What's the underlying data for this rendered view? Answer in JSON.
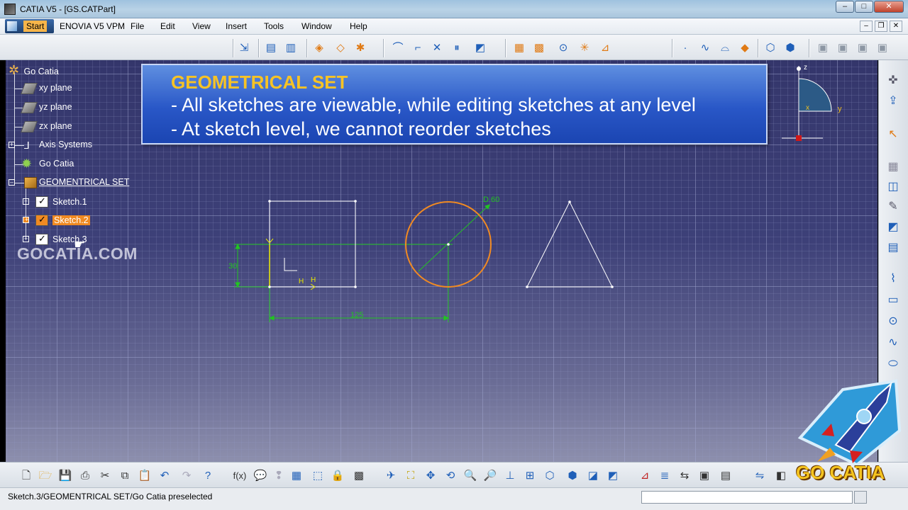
{
  "window": {
    "title": "CATIA V5 - [GS.CATPart]",
    "controls": [
      "–",
      "□",
      "✕"
    ]
  },
  "menu": {
    "start": "Start",
    "items": [
      "ENOVIA V5 VPM",
      "File",
      "Edit",
      "View",
      "Insert",
      "Tools",
      "Window",
      "Help"
    ]
  },
  "tree": {
    "root": "Go Catia",
    "items": [
      {
        "label": "xy plane",
        "icon": "plane-icon"
      },
      {
        "label": "yz plane",
        "icon": "plane-icon"
      },
      {
        "label": "zx plane",
        "icon": "plane-icon"
      },
      {
        "label": "Axis Systems",
        "icon": "axis-icon"
      },
      {
        "label": "Go Catia",
        "icon": "partbody-icon"
      },
      {
        "label": "GEOMENTRICAL SET",
        "icon": "geometrical-set-icon"
      },
      {
        "label": "Sketch.1",
        "icon": "sketch-icon"
      },
      {
        "label": "Sketch.2",
        "icon": "sketch-icon",
        "selected": true
      },
      {
        "label": "Sketch.3",
        "icon": "sketch-icon"
      }
    ]
  },
  "watermark": "GOCATIA.COM",
  "banner": {
    "title": "GEOMETRICAL SET",
    "line1": "- All sketches are viewable, while editing sketches at any level",
    "line2": "- At sketch level, we cannot reorder sketches"
  },
  "sketch": {
    "dim_diameter": "D 60",
    "dim_height": "30",
    "dim_length": "125",
    "constraint_h1": "H",
    "constraint_h2": "H",
    "colors": {
      "geometry": "#ffffff",
      "constraint": "#22c322",
      "highlight": "#f08a22",
      "selected": "#e6e600"
    }
  },
  "compass": {
    "z": "z",
    "x": "x",
    "y": "y"
  },
  "status": {
    "text": "Sketch.3/GEOMENTRICAL SET/Go Catia preselected"
  },
  "logo": {
    "text": "GO CATIA"
  }
}
